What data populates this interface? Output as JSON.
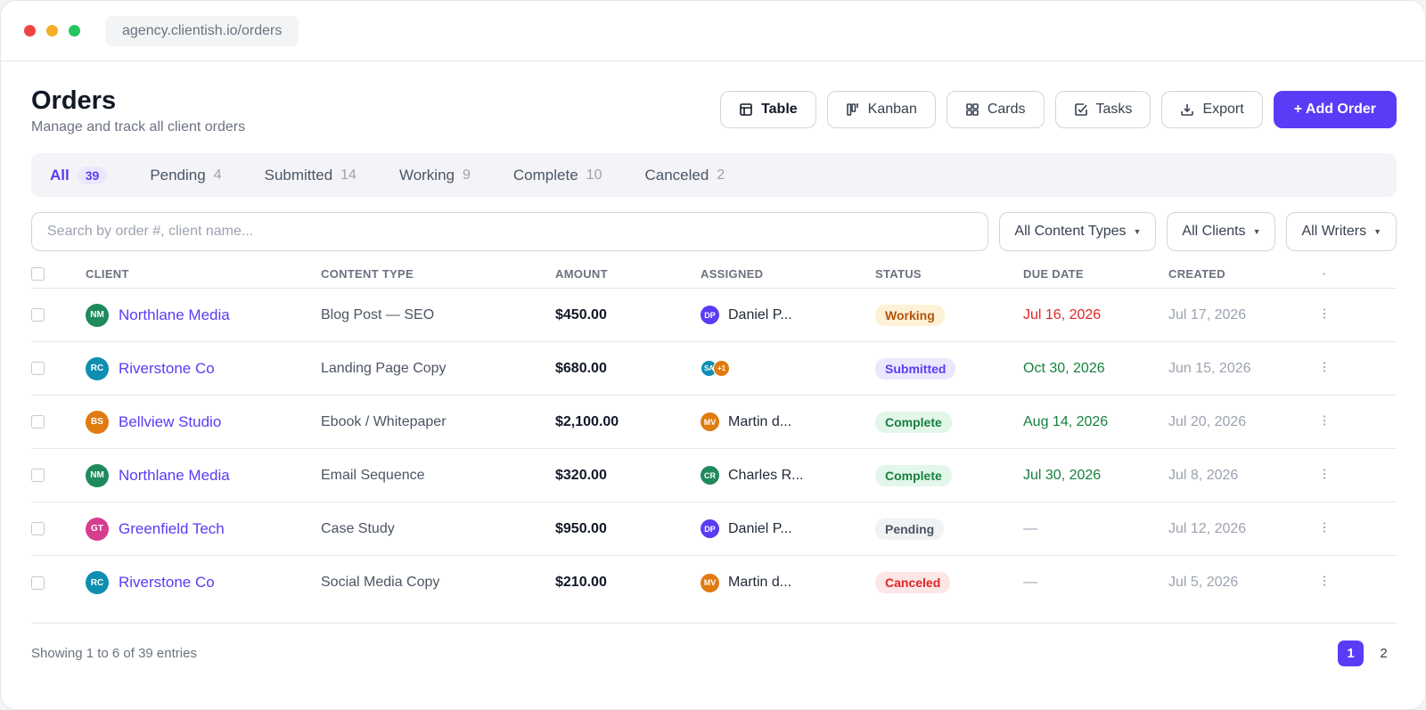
{
  "browser": {
    "url": "agency.clientish.io/orders",
    "dot_colors": [
      "#ef4444",
      "#f5b027",
      "#22c55e"
    ]
  },
  "header": {
    "title": "Orders",
    "subtitle": "Manage and track all client orders"
  },
  "actions": {
    "table": {
      "label": "Table",
      "icon": "table-icon"
    },
    "kanban": {
      "label": "Kanban",
      "icon": "kanban-icon"
    },
    "cards": {
      "label": "Cards",
      "icon": "grid-icon"
    },
    "tasks": {
      "label": "Tasks",
      "icon": "checkbox-icon"
    },
    "export": {
      "label": "Export",
      "icon": "download-icon"
    },
    "add_order": {
      "label": "+ Add Order"
    }
  },
  "tabs": [
    {
      "label": "All",
      "count": "39",
      "active": true
    },
    {
      "label": "Pending",
      "count": "4"
    },
    {
      "label": "Submitted",
      "count": "14"
    },
    {
      "label": "Working",
      "count": "9"
    },
    {
      "label": "Complete",
      "count": "10"
    },
    {
      "label": "Canceled",
      "count": "2"
    }
  ],
  "filters": {
    "search_placeholder": "Search by order #, client name...",
    "content_types": "All Content Types",
    "clients": "All Clients",
    "writers": "All Writers"
  },
  "table": {
    "columns": [
      "CLIENT",
      "CONTENT TYPE",
      "AMOUNT",
      "ASSIGNED",
      "STATUS",
      "DUE DATE",
      "CREATED",
      "·"
    ],
    "rows": [
      {
        "client": "Northlane Media",
        "client_initials": "NM",
        "client_color": "#1f8a5c",
        "content_type": "Blog Post — SEO",
        "amount": "$450.00",
        "assigned": [
          {
            "initials": "DP",
            "color": "#5b3bf5",
            "name": "Daniel P..."
          }
        ],
        "status": "Working",
        "due": "Jul 16, 2026",
        "due_color": "#dc2626",
        "created": "Jul 17, 2026"
      },
      {
        "client": "Riverstone Co",
        "client_initials": "RC",
        "client_color": "#0e8fb0",
        "content_type": "Landing Page Copy",
        "amount": "$680.00",
        "assigned": [
          {
            "initials": "SA",
            "color": "#0e8fb0"
          },
          {
            "initials": "+1",
            "color": "#e07b10"
          }
        ],
        "status": "Submitted",
        "due": "Oct 30, 2026",
        "due_color": "#15803d",
        "created": "Jun 15, 2026"
      },
      {
        "client": "Bellview Studio",
        "client_initials": "BS",
        "client_color": "#e07b10",
        "content_type": "Ebook / Whitepaper",
        "amount": "$2,100.00",
        "assigned": [
          {
            "initials": "MV",
            "color": "#e07b10",
            "name": "Martin d..."
          }
        ],
        "status": "Complete",
        "due": "Aug 14, 2026",
        "due_color": "#15803d",
        "created": "Jul 20, 2026"
      },
      {
        "client": "Northlane Media",
        "client_initials": "NM",
        "client_color": "#1f8a5c",
        "content_type": "Email Sequence",
        "amount": "$320.00",
        "assigned": [
          {
            "initials": "CR",
            "color": "#1f8a5c",
            "name": "Charles R..."
          }
        ],
        "status": "Complete",
        "due": "Jul 30, 2026",
        "due_color": "#15803d",
        "created": "Jul 8, 2026"
      },
      {
        "client": "Greenfield Tech",
        "client_initials": "GT",
        "client_color": "#d63d8f",
        "content_type": "Case Study",
        "amount": "$950.00",
        "assigned": [
          {
            "initials": "DP",
            "color": "#5b3bf5",
            "name": "Daniel P..."
          }
        ],
        "status": "Pending",
        "due": "—",
        "due_color": "#9ca3af",
        "created": "Jul 12, 2026"
      },
      {
        "client": "Riverstone Co",
        "client_initials": "RC",
        "client_color": "#0e8fb0",
        "content_type": "Social Media Copy",
        "amount": "$210.00",
        "assigned": [
          {
            "initials": "MV",
            "color": "#e07b10",
            "name": "Martin d..."
          }
        ],
        "status": "Canceled",
        "due": "—",
        "due_color": "#9ca3af",
        "created": "Jul 5, 2026"
      }
    ]
  },
  "status_styles": {
    "Working": {
      "bg": "#fdf1d6",
      "fg": "#b45309"
    },
    "Submitted": {
      "bg": "#ebe8fd",
      "fg": "#5b3bf5"
    },
    "Complete": {
      "bg": "#e3f6ea",
      "fg": "#15803d"
    },
    "Pending": {
      "bg": "#f1f2f4",
      "fg": "#4b5563"
    },
    "Canceled": {
      "bg": "#fde6e6",
      "fg": "#dc2626"
    }
  },
  "footer": {
    "showing": "Showing 1 to 6 of 39 entries",
    "pages": [
      "1",
      "2"
    ],
    "current_page": "1"
  },
  "menu_icon": "more-vertical-icon"
}
